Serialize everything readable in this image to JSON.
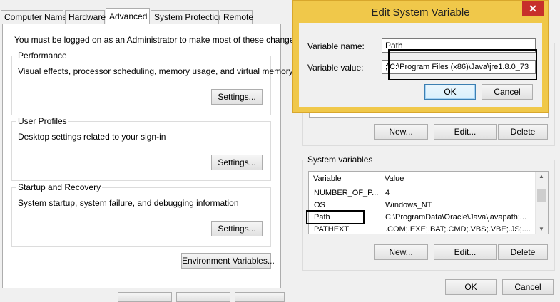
{
  "tabs": [
    "Computer Name",
    "Hardware",
    "Advanced",
    "System Protection",
    "Remote"
  ],
  "advanced": {
    "admin_note": "You must be logged on as an Administrator to make most of these changes.",
    "performance": {
      "label": "Performance",
      "desc": "Visual effects, processor scheduling, memory usage, and virtual memory",
      "button": "Settings..."
    },
    "user_profiles": {
      "label": "User Profiles",
      "desc": "Desktop settings related to your sign-in",
      "button": "Settings..."
    },
    "startup": {
      "label": "Startup and Recovery",
      "desc": "System startup, system failure, and debugging information",
      "button": "Settings..."
    },
    "env_button": "Environment Variables..."
  },
  "user_vars": {
    "new": "New...",
    "edit": "Edit...",
    "delete": "Delete"
  },
  "system_vars": {
    "label": "System variables",
    "col_variable": "Variable",
    "col_value": "Value",
    "rows": [
      {
        "name": "NUMBER_OF_P...",
        "value": "4"
      },
      {
        "name": "OS",
        "value": "Windows_NT"
      },
      {
        "name": "Path",
        "value": "C:\\ProgramData\\Oracle\\Java\\javapath;..."
      },
      {
        "name": "PATHEXT",
        "value": ".COM;.EXE;.BAT;.CMD;.VBS;.VBE;.JS;...."
      }
    ],
    "new": "New...",
    "edit": "Edit...",
    "delete": "Delete"
  },
  "env_footer": {
    "ok": "OK",
    "cancel": "Cancel"
  },
  "dialog": {
    "title": "Edit System Variable",
    "close": "✕",
    "name_label": "Variable name:",
    "name_value": "Path",
    "value_label": "Variable value:",
    "value_value": ";\\C:\\Program Files (x86)\\Java\\jre1.8.0_73",
    "ok": "OK",
    "cancel": "Cancel"
  },
  "colors": {
    "dialog_frame": "#f0c84a",
    "close": "#c7302b"
  }
}
